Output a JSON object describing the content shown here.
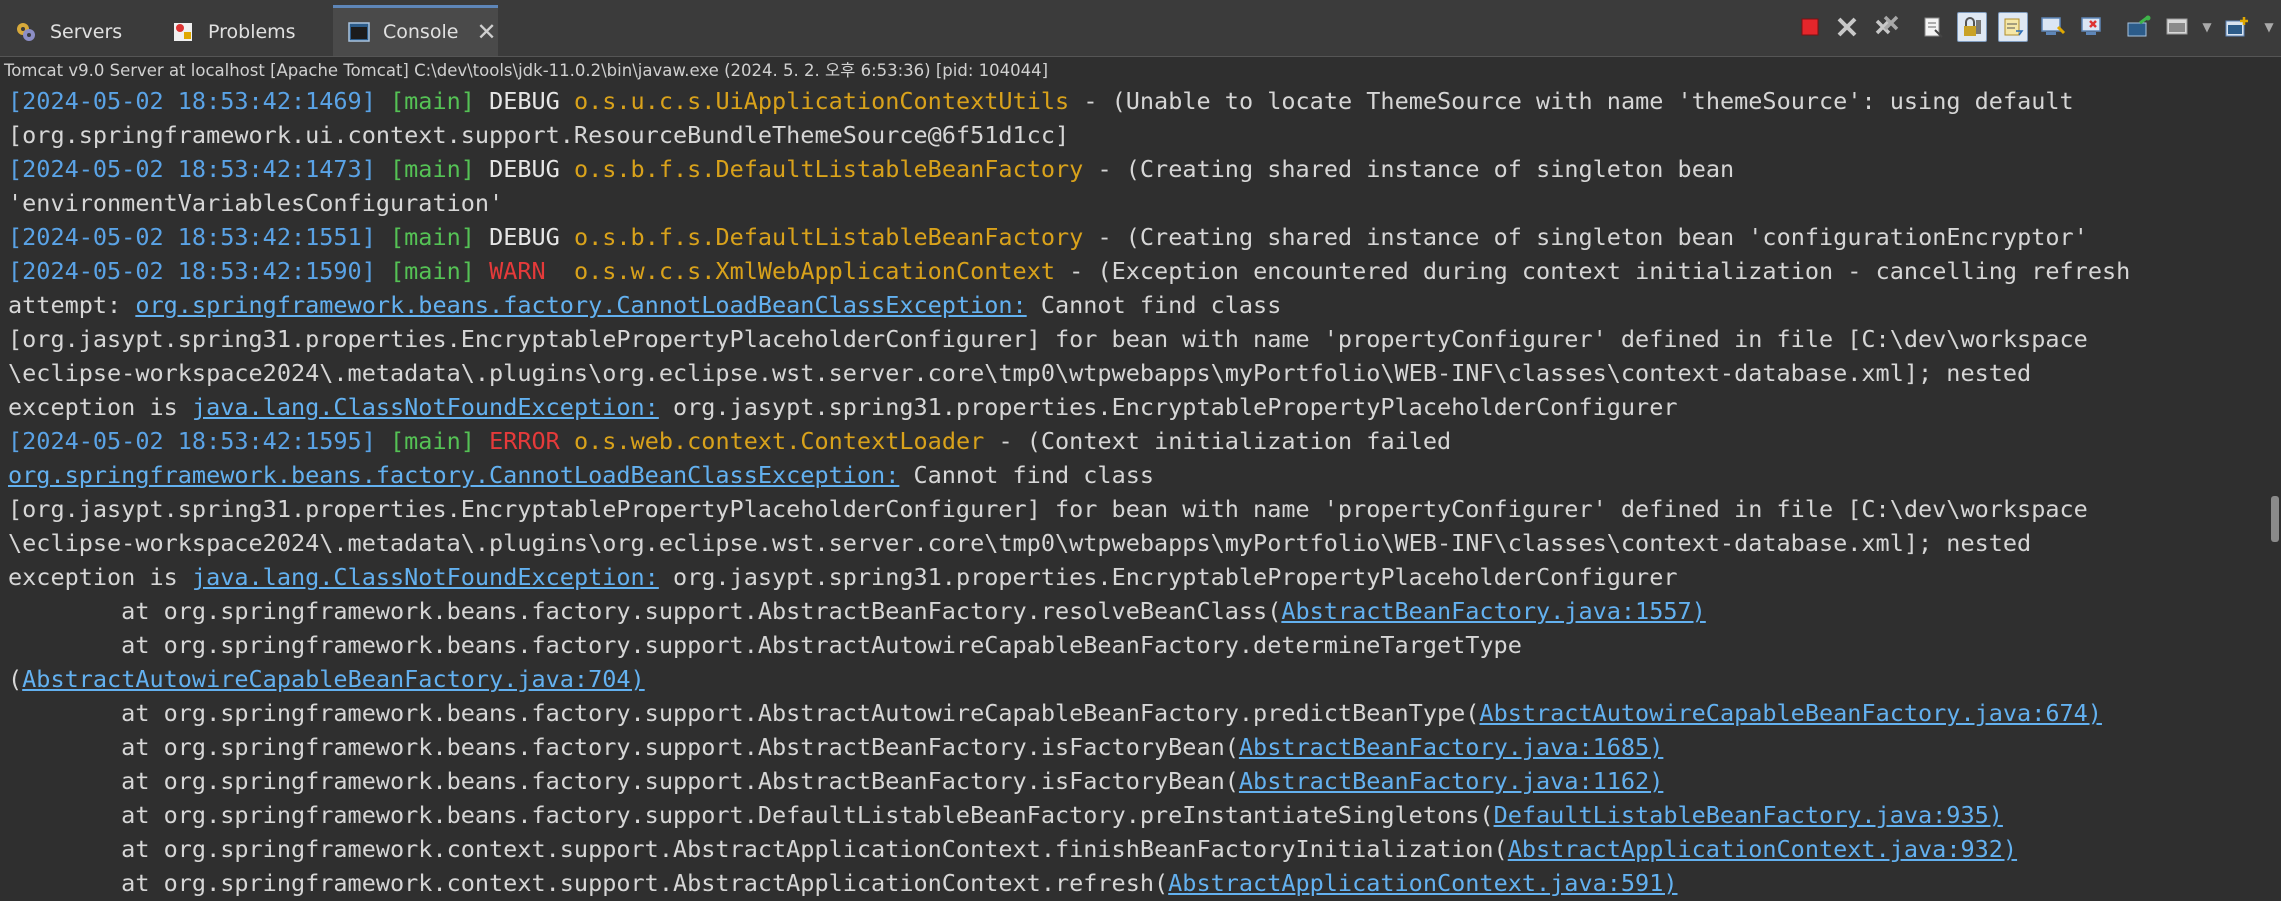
{
  "tabs": [
    {
      "label": "Servers",
      "icon": "servers-icon"
    },
    {
      "label": "Problems",
      "icon": "problems-icon"
    },
    {
      "label": "Console",
      "icon": "console-icon",
      "active": true,
      "close": "✕"
    }
  ],
  "toolbar": {
    "icons": [
      "terminate-icon",
      "remove-launch-icon",
      "remove-all-terminated-icon",
      "clear-console-icon",
      "scroll-lock-icon",
      "word-wrap-icon",
      "show-console-on-stdout-icon",
      "show-console-on-stderr-icon",
      "pin-console-icon",
      "display-selected-console-icon",
      "open-console-icon"
    ]
  },
  "process_line": "Tomcat v9.0 Server at localhost [Apache Tomcat] C:\\dev\\tools\\jdk-11.0.2\\bin\\javaw.exe  (2024. 5. 2. 오후 6:53:36) [pid: 104044]",
  "log": {
    "l1": {
      "ts": "[2024-05-02 18:53:42:1469]",
      "thread": "[main]",
      "level": "DEBUG",
      "logger": "o.s.u.c.s.UiApplicationContextUtils",
      "msg": "- (Unable to locate ThemeSource with name 'themeSource': using default"
    },
    "l1b": "[org.springframework.ui.context.support.ResourceBundleThemeSource@6f51d1cc]",
    "l2": {
      "ts": "[2024-05-02 18:53:42:1473]",
      "thread": "[main]",
      "level": "DEBUG",
      "logger": "o.s.b.f.s.DefaultListableBeanFactory",
      "msg": "- (Creating shared instance of singleton bean"
    },
    "l2b": "'environmentVariablesConfiguration'",
    "l3": {
      "ts": "[2024-05-02 18:53:42:1551]",
      "thread": "[main]",
      "level": "DEBUG",
      "logger": "o.s.b.f.s.DefaultListableBeanFactory",
      "msg": "- (Creating shared instance of singleton bean 'configurationEncryptor'"
    },
    "l4": {
      "ts": "[2024-05-02 18:53:42:1590]",
      "thread": "[main]",
      "level": "WARN",
      "logger": "o.s.w.c.s.XmlWebApplicationContext",
      "msg": "- (Exception encountered during context initialization - cancelling refresh"
    },
    "l4b": {
      "pre": "attempt: ",
      "link": "org.springframework.beans.factory.CannotLoadBeanClassException:",
      "post": " Cannot find class"
    },
    "l4c": "[org.jasypt.spring31.properties.EncryptablePropertyPlaceholderConfigurer] for bean with name 'propertyConfigurer' defined in file [C:\\dev\\workspace",
    "l4d": "\\eclipse-workspace2024\\.metadata\\.plugins\\org.eclipse.wst.server.core\\tmp0\\wtpwebapps\\myPortfolio\\WEB-INF\\classes\\context-database.xml]; nested",
    "l4e": {
      "pre": "exception is ",
      "link": "java.lang.ClassNotFoundException:",
      "post": " org.jasypt.spring31.properties.EncryptablePropertyPlaceholderConfigurer"
    },
    "l5": {
      "ts": "[2024-05-02 18:53:42:1595]",
      "thread": "[main]",
      "level": "ERROR",
      "logger": "o.s.web.context.ContextLoader",
      "msg": "- (Context initialization failed"
    },
    "l5b": {
      "link": "org.springframework.beans.factory.CannotLoadBeanClassException:",
      "post": " Cannot find class"
    },
    "l5c": "[org.jasypt.spring31.properties.EncryptablePropertyPlaceholderConfigurer] for bean with name 'propertyConfigurer' defined in file [C:\\dev\\workspace",
    "l5d": "\\eclipse-workspace2024\\.metadata\\.plugins\\org.eclipse.wst.server.core\\tmp0\\wtpwebapps\\myPortfolio\\WEB-INF\\classes\\context-database.xml]; nested",
    "l5e": {
      "pre": "exception is ",
      "link": "java.lang.ClassNotFoundException:",
      "post": " org.jasypt.spring31.properties.EncryptablePropertyPlaceholderConfigurer"
    }
  },
  "stack": [
    {
      "pre": "        at org.springframework.beans.factory.support.AbstractBeanFactory.resolveBeanClass(",
      "link": "AbstractBeanFactory.java:1557)"
    },
    {
      "pre": "        at org.springframework.beans.factory.support.AbstractAutowireCapableBeanFactory.determineTargetType",
      "link": ""
    },
    {
      "pre": "(",
      "link": "AbstractAutowireCapableBeanFactory.java:704)"
    },
    {
      "pre": "        at org.springframework.beans.factory.support.AbstractAutowireCapableBeanFactory.predictBeanType(",
      "link": "AbstractAutowireCapableBeanFactory.java:674)"
    },
    {
      "pre": "        at org.springframework.beans.factory.support.AbstractBeanFactory.isFactoryBean(",
      "link": "AbstractBeanFactory.java:1685)"
    },
    {
      "pre": "        at org.springframework.beans.factory.support.AbstractBeanFactory.isFactoryBean(",
      "link": "AbstractBeanFactory.java:1162)"
    },
    {
      "pre": "        at org.springframework.beans.factory.support.DefaultListableBeanFactory.preInstantiateSingletons(",
      "link": "DefaultListableBeanFactory.java:935)"
    },
    {
      "pre": "        at org.springframework.context.support.AbstractApplicationContext.finishBeanFactoryInitialization(",
      "link": "AbstractApplicationContext.java:932)"
    },
    {
      "pre": "        at org.springframework.context.support.AbstractApplicationContext.refresh(",
      "link": "AbstractApplicationContext.java:591)"
    }
  ]
}
